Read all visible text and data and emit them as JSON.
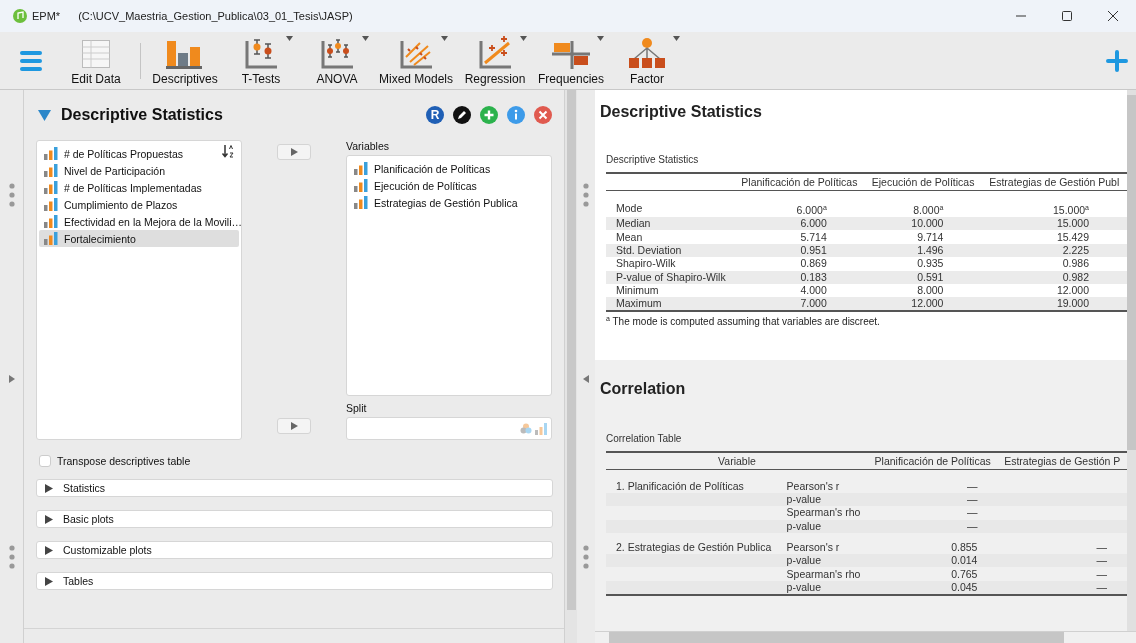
{
  "window": {
    "title": "EPM*",
    "path": "(C:\\UCV_Maestria_Gestion_Publica\\03_01_Tesis\\JASP)"
  },
  "toolbar": {
    "items": [
      {
        "label": "Edit Data",
        "kind": "edit",
        "has_menu": false
      },
      {
        "label": "Descriptives",
        "kind": "descriptives",
        "has_menu": false
      },
      {
        "label": "T-Tests",
        "kind": "ttest",
        "has_menu": true
      },
      {
        "label": "ANOVA",
        "kind": "anova",
        "has_menu": true
      },
      {
        "label": "Mixed Models",
        "kind": "mixed",
        "has_menu": true
      },
      {
        "label": "Regression",
        "kind": "regression",
        "has_menu": true
      },
      {
        "label": "Frequencies",
        "kind": "frequencies",
        "has_menu": true
      },
      {
        "label": "Factor",
        "kind": "factor",
        "has_menu": true
      }
    ]
  },
  "options": {
    "title": "Descriptive Statistics",
    "expanded": true,
    "actions": [
      {
        "kind": "r",
        "label": "R"
      },
      {
        "kind": "edit"
      },
      {
        "kind": "add"
      },
      {
        "kind": "info"
      },
      {
        "kind": "close"
      }
    ],
    "available": [
      {
        "name": "# de Políticas Propuestas",
        "selected": false
      },
      {
        "name": "Nivel de Participación",
        "selected": false
      },
      {
        "name": "# de Políticas Implementadas",
        "selected": false
      },
      {
        "name": "Cumplimiento de Plazos",
        "selected": false
      },
      {
        "name": "Efectividad en la Mejora de la Movili…",
        "selected": false
      },
      {
        "name": "Fortalecimiento",
        "selected": true
      }
    ],
    "variables_label": "Variables",
    "variables": [
      "Planificación de Políticas",
      "Ejecución de Políticas",
      "Estrategias de Gestión Publica"
    ],
    "split_label": "Split",
    "transpose": {
      "label": "Transpose descriptives table",
      "checked": false
    },
    "sections": [
      {
        "label": "Statistics",
        "expanded": false
      },
      {
        "label": "Basic plots",
        "expanded": false
      },
      {
        "label": "Customizable plots",
        "expanded": false
      },
      {
        "label": "Tables",
        "expanded": false
      }
    ]
  },
  "output": {
    "descriptives": {
      "heading": "Descriptive Statistics",
      "active": true,
      "table_title": "Descriptive Statistics",
      "columns": [
        "Planificación de Políticas",
        "Ejecución de Políticas",
        "Estrategias de Gestión Publ"
      ],
      "rows": [
        {
          "label": "Mode",
          "values": [
            "6.000$^{a}$",
            "8.000$^{a}$",
            "15.000$^{a}$"
          ]
        },
        {
          "label": "Median",
          "values": [
            "6.000",
            "10.000",
            "15.000"
          ]
        },
        {
          "label": "Mean",
          "values": [
            "5.714",
            "9.714",
            "15.429"
          ]
        },
        {
          "label": "Std. Deviation",
          "values": [
            "0.951",
            "1.496",
            "2.225"
          ]
        },
        {
          "label": "Shapiro-Wilk",
          "values": [
            "0.869",
            "0.935",
            "0.986"
          ]
        },
        {
          "label": "P-value of Shapiro-Wilk",
          "values": [
            "0.183",
            "0.591",
            "0.982"
          ]
        },
        {
          "label": "Minimum",
          "values": [
            "4.000",
            "8.000",
            "12.000"
          ]
        },
        {
          "label": "Maximum",
          "values": [
            "7.000",
            "12.000",
            "19.000"
          ]
        }
      ],
      "footnote": "$^{a}$ The mode is computed assuming that variables are discreet."
    },
    "correlation": {
      "heading": "Correlation",
      "active": false,
      "table_title": "Correlation Table",
      "columns": [
        "Variable",
        "Planificación de Políticas",
        "Estrategias de Gestión P"
      ],
      "groups": [
        {
          "variable": "1. Planificación de Políticas",
          "rows": [
            {
              "stat": "Pearson's r",
              "values": [
                "—"
              ]
            },
            {
              "stat": "p-value",
              "values": [
                "—"
              ]
            },
            {
              "stat": "Spearman's rho",
              "values": [
                "—"
              ]
            },
            {
              "stat": "p-value",
              "values": [
                "—"
              ]
            }
          ]
        },
        {
          "variable": "2. Estrategias de Gestión Publica",
          "rows": [
            {
              "stat": "Pearson's r",
              "values": [
                "0.855",
                "—"
              ]
            },
            {
              "stat": "p-value",
              "values": [
                "0.014",
                "—"
              ]
            },
            {
              "stat": "Spearman's rho",
              "values": [
                "0.765",
                "—"
              ]
            },
            {
              "stat": "p-value",
              "values": [
                "0.045",
                "—"
              ]
            }
          ]
        }
      ]
    }
  }
}
